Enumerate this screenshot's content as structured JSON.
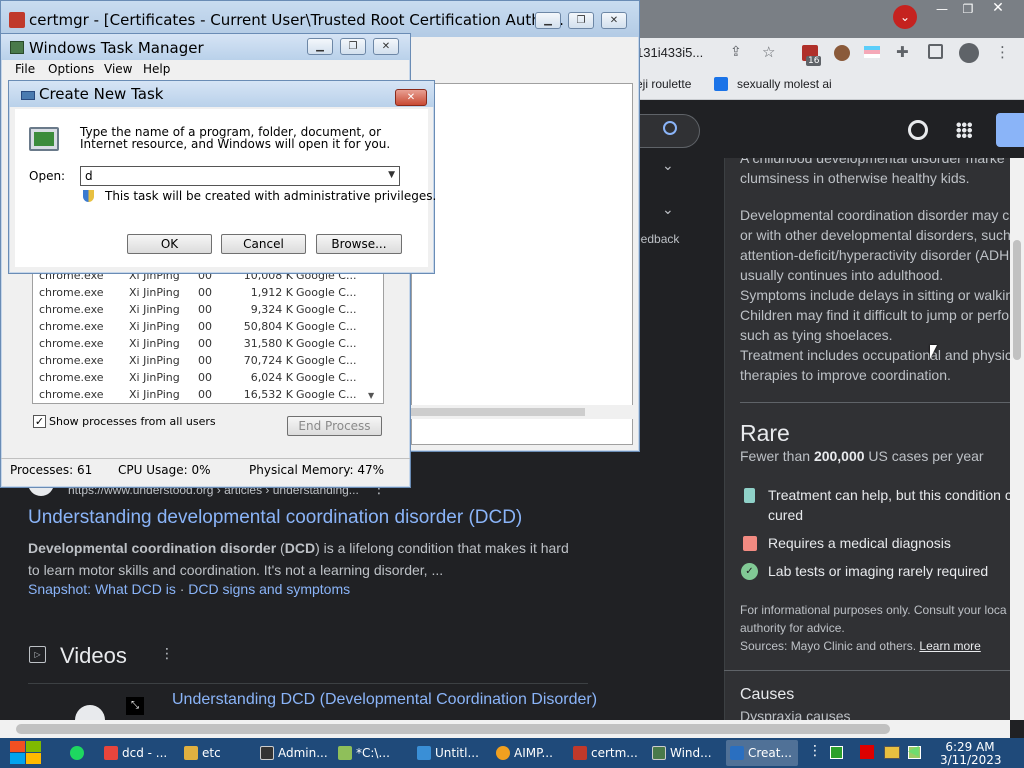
{
  "certmgr": {
    "title": "certmgr - [Certificates - Current User\\Trusted Root Certification Autho..."
  },
  "taskmgr": {
    "title": "Windows Task Manager",
    "menu": [
      "File",
      "Options",
      "View",
      "Help"
    ],
    "processes": [
      {
        "name": "chrome.exe",
        "user": "Xi JinPing",
        "cpu": "00",
        "mem": "10,008 K",
        "desc": "Google C..."
      },
      {
        "name": "chrome.exe",
        "user": "Xi JinPing",
        "cpu": "00",
        "mem": "1,912 K",
        "desc": "Google C..."
      },
      {
        "name": "chrome.exe",
        "user": "Xi JinPing",
        "cpu": "00",
        "mem": "9,324 K",
        "desc": "Google C..."
      },
      {
        "name": "chrome.exe",
        "user": "Xi JinPing",
        "cpu": "00",
        "mem": "50,804 K",
        "desc": "Google C..."
      },
      {
        "name": "chrome.exe",
        "user": "Xi JinPing",
        "cpu": "00",
        "mem": "31,580 K",
        "desc": "Google C..."
      },
      {
        "name": "chrome.exe",
        "user": "Xi JinPing",
        "cpu": "00",
        "mem": "70,724 K",
        "desc": "Google C..."
      },
      {
        "name": "chrome.exe",
        "user": "Xi JinPing",
        "cpu": "00",
        "mem": "6,024 K",
        "desc": "Google C..."
      },
      {
        "name": "chrome.exe",
        "user": "Xi JinPing",
        "cpu": "00",
        "mem": "16,532 K",
        "desc": "Google C..."
      }
    ],
    "show_all_label": "Show processes from all users",
    "show_all_checked": true,
    "end_process_label": "End Process",
    "status": {
      "processes": "Processes: 61",
      "cpu": "CPU Usage: 0%",
      "memory": "Physical Memory: 47%"
    }
  },
  "dialog": {
    "title": "Create New Task",
    "description": "Type the name of a program, folder, document, or Internet resource, and Windows will open it for you.",
    "open_label": "Open:",
    "open_value": "d",
    "admin_note": "This task will be created with administrative privileges.",
    "ok": "OK",
    "cancel": "Cancel",
    "browse": "Browse..."
  },
  "chrome": {
    "url_fragment": "131i433i5...",
    "badge": "16",
    "bookmarks": [
      "eji roulette",
      "sexually molest ai"
    ]
  },
  "search": {
    "feedback": "eedback",
    "result": {
      "url": "https://www.understood.org › articles › understanding...",
      "title": "Understanding developmental coordination disorder (DCD)",
      "snippet_bold1": "Developmental coordination disorder",
      "snippet_mid": " (",
      "snippet_bold2": "DCD",
      "snippet_rest": ") is a lifelong condition that makes it hard to learn motor skills and coordination. It's not a learning disorder, ...",
      "sublink1": "Snapshot: What DCD is",
      "sublink_sep": " · ",
      "sublink2": "DCD signs and symptoms"
    },
    "videos_heading": "Videos",
    "video_title": "Understanding DCD (Developmental Coordination Disorder)"
  },
  "knowledge_panel": {
    "intro1": "A childhood developmental disorder marke",
    "intro2": "clumsiness in otherwise healthy kids.",
    "para": [
      "Developmental coordination disorder may c",
      "or with other developmental disorders, such",
      "attention-deficit/hyperactivity disorder (ADH",
      "usually continues into adulthood.",
      "Symptoms include delays in sitting or walkin",
      "Children may find it difficult to jump or perfo",
      "such as tying shoelaces.",
      "Treatment includes occupational and physic",
      "therapies to improve coordination."
    ],
    "rare_heading": "Rare",
    "rare_sub_pre": "Fewer than ",
    "rare_sub_bold": "200,000",
    "rare_sub_post": " US cases per year",
    "facts": [
      {
        "icon": "bottle-icon",
        "line1": "Treatment can help, but this condition c",
        "line2": "cured"
      },
      {
        "icon": "calendar-icon",
        "line1": "Requires a medical diagnosis",
        "line2": ""
      },
      {
        "icon": "lab-icon",
        "line1": "Lab tests or imaging rarely required",
        "line2": ""
      }
    ],
    "disclaimer1": "For informational purposes only. Consult your loca",
    "disclaimer2": "authority for advice.",
    "sources_pre": "Sources: Mayo Clinic and others. ",
    "learn_more": "Learn more",
    "causes_heading": "Causes",
    "causes_sub": "Dyspraxia causes"
  },
  "taskbar": {
    "items": [
      {
        "label": "dcd - ...",
        "color": "#e8453c"
      },
      {
        "label": "etc",
        "color": "#e0b040"
      },
      {
        "label": "Admin...",
        "color": "#333"
      },
      {
        "label": "*C:\\...",
        "color": "#8fbf5a"
      },
      {
        "label": "Untitl...",
        "color": "#3a8fd6"
      },
      {
        "label": "AIMP...",
        "color": "#f0a020"
      },
      {
        "label": "certm...",
        "color": "#c0392b"
      },
      {
        "label": "Wind...",
        "color": "#4a7a4a"
      },
      {
        "label": "Creat...",
        "color": "#2a6fc0"
      }
    ],
    "time": "6:29 AM",
    "date": "3/11/2023"
  },
  "colors": {
    "accent": "#8ab4f8",
    "panel_bg": "#202124",
    "xp_title": "#c8dbf0"
  }
}
